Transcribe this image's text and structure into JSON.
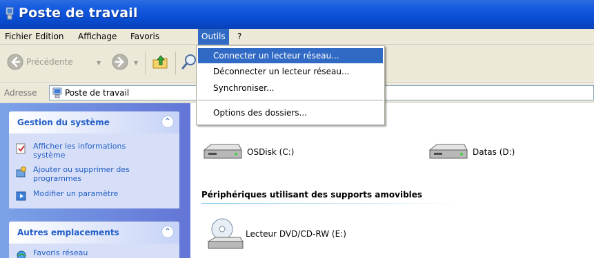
{
  "window": {
    "title": "Poste de travail"
  },
  "menubar": {
    "items": [
      "Fichier",
      "Edition",
      "Affichage",
      "Favoris",
      "Outils",
      "?"
    ],
    "active": "Outils"
  },
  "toolbar": {
    "back_label": "Précédente"
  },
  "address": {
    "label": "Adresse",
    "value": "Poste de travail"
  },
  "dropdown": {
    "items": [
      "Connecter un lecteur réseau...",
      "Déconnecter un lecteur réseau...",
      "Synchroniser...",
      "Options des dossiers..."
    ],
    "highlighted": "Connecter un lecteur réseau..."
  },
  "sidebar": {
    "system_box": {
      "title": "Gestion du système",
      "tasks": [
        "Afficher les informations système",
        "Ajouter ou supprimer des programmes",
        "Modifier un paramètre"
      ]
    },
    "places_box": {
      "title": "Autres emplacements",
      "tasks": [
        "Favoris réseau"
      ]
    }
  },
  "main": {
    "drives": [
      "OSDisk (C:)",
      "Datas (D:)"
    ],
    "removable_section": "Périphériques utilisant des supports amovibles",
    "removable": [
      "Lecteur DVD/CD-RW (E:)"
    ]
  },
  "colors": {
    "titlebar": "#0a4fd6",
    "menu_highlight": "#316ac5",
    "link_blue": "#215dc6",
    "sidebar_bg": "#6f8fdf"
  }
}
